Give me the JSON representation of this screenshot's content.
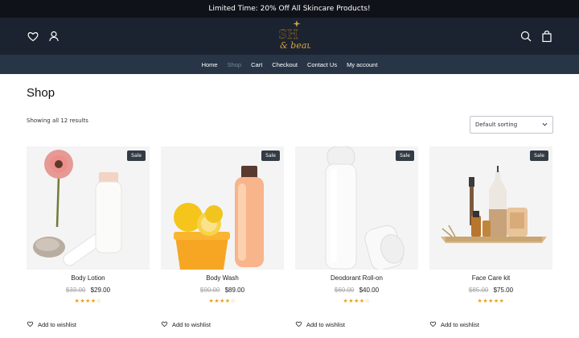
{
  "promo": {
    "text": "Limited Time: 20% Off All Skincare Products!"
  },
  "header": {
    "icons": [
      "heart-icon",
      "user-icon",
      "search-icon",
      "bag-icon"
    ],
    "logo": {
      "text": "S beauty",
      "accent": "#d9a441"
    }
  },
  "nav": {
    "items": [
      {
        "label": "Home",
        "active": false
      },
      {
        "label": "Shop",
        "active": true
      },
      {
        "label": "Cart",
        "active": false
      },
      {
        "label": "Checkout",
        "active": false
      },
      {
        "label": "Contact Us",
        "active": false
      },
      {
        "label": "My account",
        "active": false
      }
    ]
  },
  "page": {
    "title": "Shop",
    "results": "Showing all 12 results",
    "sort": {
      "selected": "Default sorting"
    }
  },
  "products": [
    {
      "name": "Body Lotion",
      "old_price": "$33.00",
      "price": "$29.00",
      "rating": 4,
      "badge": "Sale",
      "wishlist": "Add to wishlist"
    },
    {
      "name": "Body Wash",
      "old_price": "$90.00",
      "price": "$89.00",
      "rating": 4,
      "badge": "Sale",
      "wishlist": "Add to wishlist"
    },
    {
      "name": "Deodorant Roll-on",
      "old_price": "$60.00",
      "price": "$40.00",
      "rating": 4,
      "badge": "Sale",
      "wishlist": "Add to wishlist"
    },
    {
      "name": "Face Care kit",
      "old_price": "$85.00",
      "price": "$75.00",
      "rating": 5,
      "badge": "Sale",
      "wishlist": "Add to wishlist"
    }
  ],
  "colors": {
    "promo_bg": "#0f1319",
    "header_bg": "#1b2330",
    "nav_bg": "#283546",
    "star": "#e8a21e",
    "sale_badge": "#333b45"
  }
}
